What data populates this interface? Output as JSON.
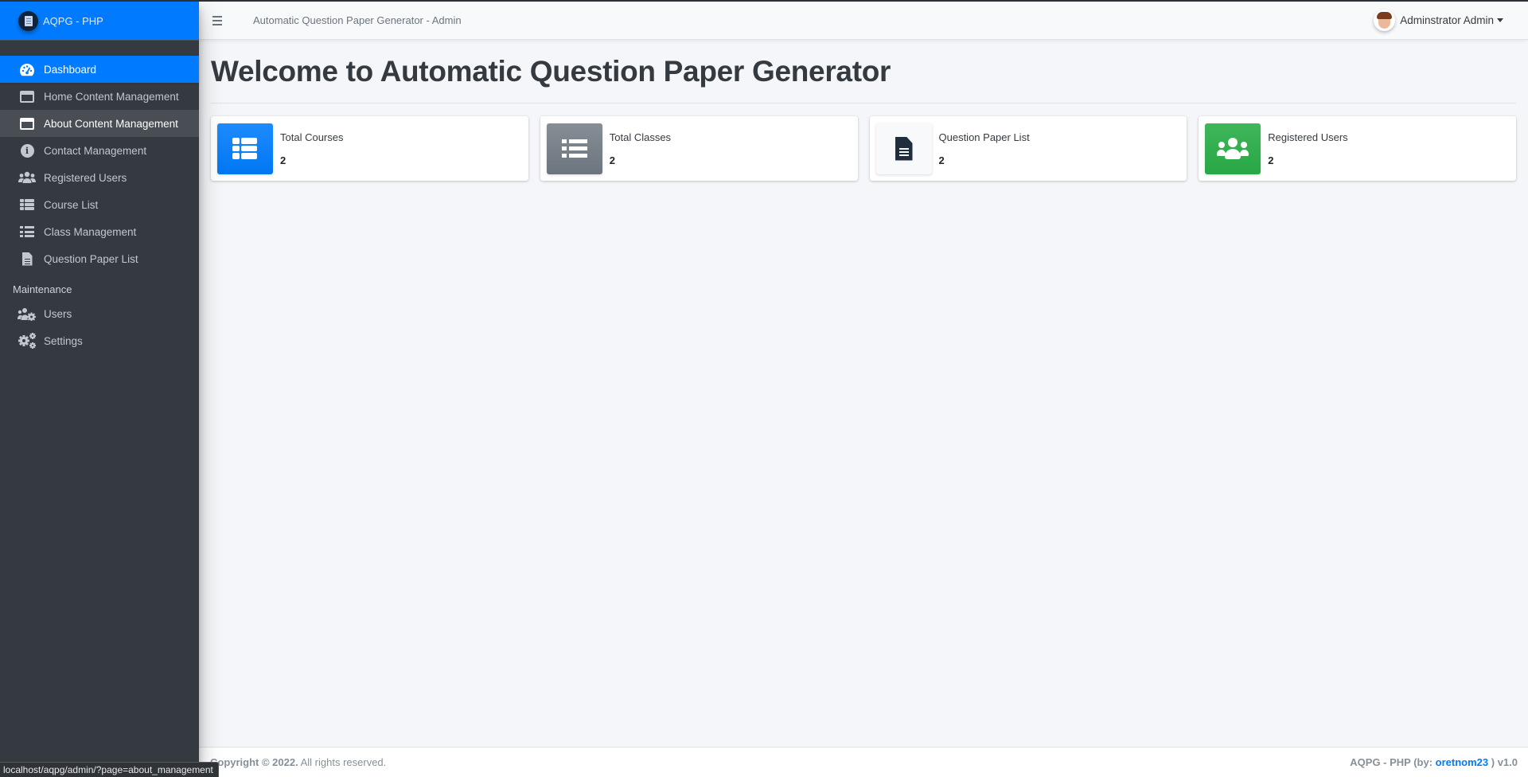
{
  "brand": {
    "name": "AQPG - PHP"
  },
  "sidebar": {
    "items": [
      {
        "label": "Dashboard",
        "icon": "tachometer-icon",
        "state": "active"
      },
      {
        "label": "Home Content Management",
        "icon": "window-icon",
        "state": ""
      },
      {
        "label": "About Content Management",
        "icon": "window-icon",
        "state": "hover"
      },
      {
        "label": "Contact Management",
        "icon": "info-circle-icon",
        "state": ""
      },
      {
        "label": "Registered Users",
        "icon": "users-icon",
        "state": ""
      },
      {
        "label": "Course List",
        "icon": "table-icon",
        "state": ""
      },
      {
        "label": "Class Management",
        "icon": "list-icon",
        "state": ""
      },
      {
        "label": "Question Paper List",
        "icon": "file-alt-icon",
        "state": ""
      }
    ],
    "maintenance_header": "Maintenance",
    "maintenance_items": [
      {
        "label": "Users",
        "icon": "users-cog-icon"
      },
      {
        "label": "Settings",
        "icon": "cogs-icon"
      }
    ]
  },
  "header": {
    "title": "Automatic Question Paper Generator - Admin",
    "user_name": "Adminstrator Admin"
  },
  "main": {
    "page_title": "Welcome to Automatic Question Paper Generator",
    "cards": [
      {
        "label": "Total Courses",
        "value": "2",
        "icon": "table-icon",
        "color": "#007bff"
      },
      {
        "label": "Total Classes",
        "value": "2",
        "icon": "list-icon",
        "color": "#6c757d"
      },
      {
        "label": "Question Paper List",
        "value": "2",
        "icon": "file-alt-icon",
        "color": "#f8f9fa"
      },
      {
        "label": "Registered Users",
        "value": "2",
        "icon": "users-icon",
        "color": "#28a745"
      }
    ]
  },
  "footer": {
    "copyright_strong": "Copyright © 2022.",
    "copyright_rest": " All rights reserved.",
    "credit_prefix": "AQPG - PHP (by: ",
    "credit_author": "oretnom23",
    "credit_suffix": " ) v1.0"
  },
  "status_bar": {
    "url": "localhost/aqpg/admin/?page=about_management"
  },
  "colors": {
    "primary": "#007bff",
    "sidebar_bg": "#343a40",
    "success": "#28a745",
    "secondary": "#6c757d"
  }
}
